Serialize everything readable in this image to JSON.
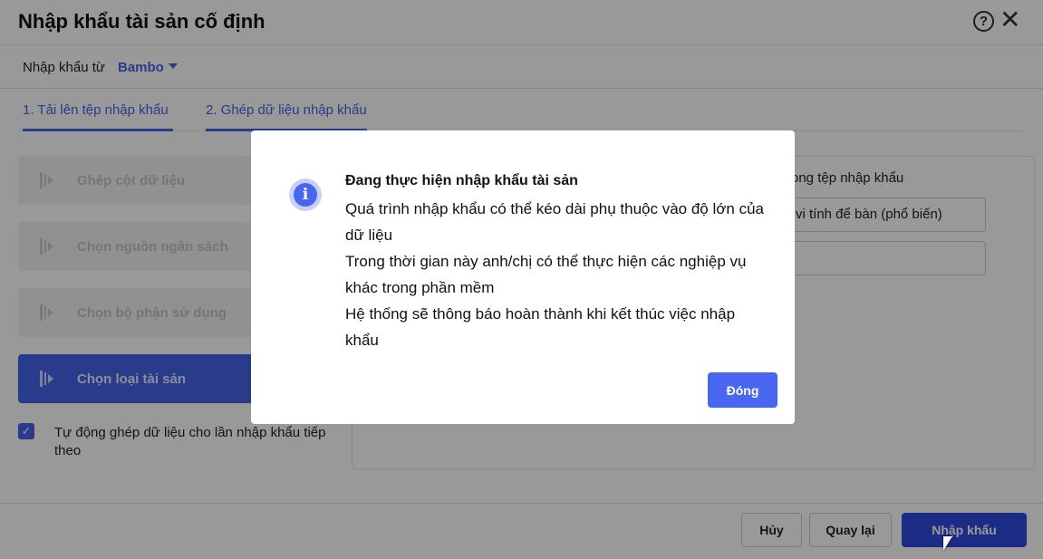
{
  "header": {
    "title": "Nhập khẩu tài sản cố định",
    "help_icon": "?",
    "close_icon": "✕"
  },
  "source": {
    "label": "Nhập khẩu từ",
    "value": "Bambo"
  },
  "tabs": [
    {
      "label": "1. Tải lên tệp nhập khẩu"
    },
    {
      "label": "2. Ghép dữ liệu nhập khẩu"
    }
  ],
  "steps": [
    {
      "label": "Ghép cột dữ liệu"
    },
    {
      "label": "Chọn nguồn ngân sách"
    },
    {
      "label": "Chọn bộ phận sử dụng"
    },
    {
      "label": "Chọn loại tài sản",
      "active": true
    }
  ],
  "auto_match": {
    "checked": true,
    "label": "Tự động ghép dữ liệu cho lần nhập khẩu tiếp theo"
  },
  "panel": {
    "label": "ong tệp nhập khẩu",
    "field1": "vi tính để bàn (phổ biến)",
    "field2": ""
  },
  "footer": {
    "cancel": "Hủy",
    "back": "Quay lại",
    "import": "Nhập khẩu"
  },
  "modal": {
    "title": "Đang thực hiện nhập khẩu tài sản",
    "lines": [
      "Quá trình nhập khẩu có thể kéo dài phụ thuộc vào độ lớn của dữ liệu",
      "Trong thời gian này anh/chị có thể thực hiện các nghiệp vụ khác trong phần mềm",
      "Hệ thống sẽ thông báo hoàn thành khi kết thúc việc nhập khẩu"
    ],
    "close": "Đóng"
  }
}
